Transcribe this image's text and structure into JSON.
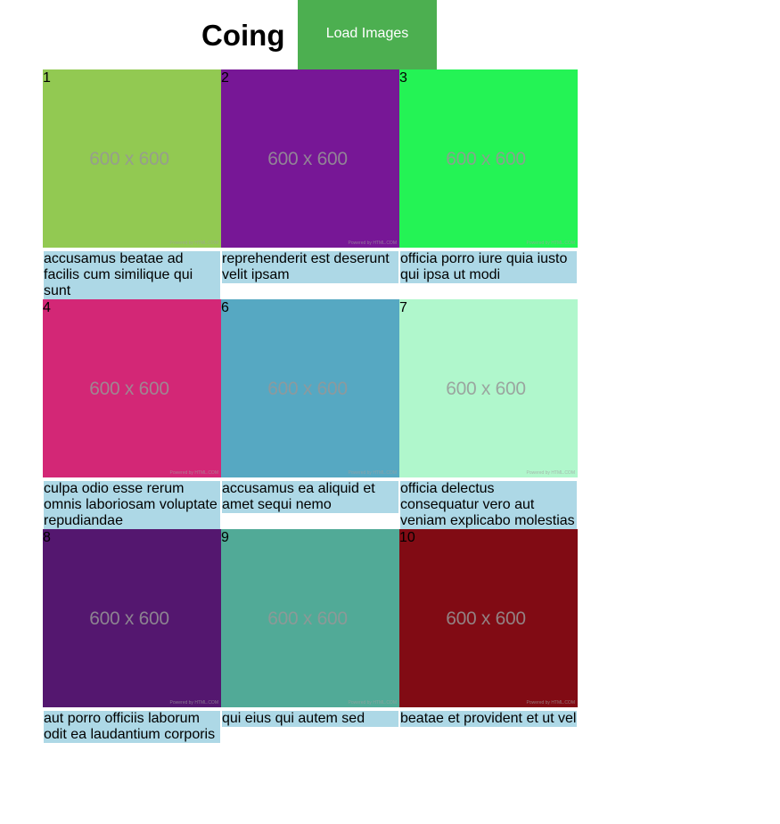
{
  "header": {
    "title": "Coing",
    "button_label": "Load Images",
    "button_color": "#4caf50"
  },
  "gallery": {
    "caption_background": "#add8e6",
    "rows": [
      [
        {
          "id": "1",
          "color": "#92c952",
          "image_label": "600 x 600",
          "powered_text": "Powered by HTML.COM",
          "caption": "accusamus beatae ad facilis cum similique qui sunt"
        },
        {
          "id": "2",
          "color": "#771796",
          "image_label": "600 x 600",
          "powered_text": "Powered by HTML.COM",
          "caption": "reprehenderit est deserunt velit ipsam"
        },
        {
          "id": "3",
          "color": "#24f355",
          "image_label": "600 x 600",
          "powered_text": "Powered by HTML.COM",
          "caption": "officia porro iure quia iusto qui ipsa ut modi"
        }
      ],
      [
        {
          "id": "4",
          "color": "#d32776",
          "image_label": "600 x 600",
          "powered_text": "Powered by HTML.COM",
          "caption": "culpa odio esse rerum omnis laboriosam voluptate repudiandae"
        },
        {
          "id": "6",
          "color": "#56a8c2",
          "image_label": "600 x 600",
          "powered_text": "Powered by HTML.COM",
          "caption": "accusamus ea aliquid et amet sequi nemo"
        },
        {
          "id": "7",
          "color": "#b0f7cc",
          "image_label": "600 x 600",
          "powered_text": "Powered by HTML.COM",
          "caption": "officia delectus consequatur vero aut veniam explicabo molestias"
        }
      ],
      [
        {
          "id": "8",
          "color": "#54176f",
          "image_label": "600 x 600",
          "powered_text": "Powered by HTML.COM",
          "caption": "aut porro officiis laborum odit ea laudantium corporis"
        },
        {
          "id": "9",
          "color": "#51aa97",
          "image_label": "600 x 600",
          "powered_text": "Powered by HTML.COM",
          "caption": "qui eius qui autem sed"
        },
        {
          "id": "10",
          "color": "#810b14",
          "image_label": "600 x 600",
          "powered_text": "Powered by HTML.COM",
          "caption": "beatae et provident et ut vel"
        }
      ]
    ]
  }
}
